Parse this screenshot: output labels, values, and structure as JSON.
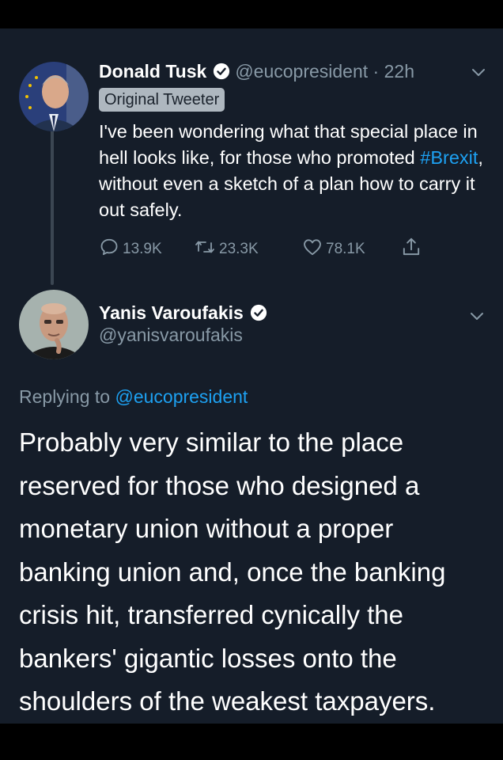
{
  "tweet": {
    "display_name": "Donald Tusk",
    "handle": "@eucopresident",
    "time": "22h",
    "badge": "Original Tweeter",
    "text_before": "I've been wondering what that special place in hell looks like, for those who promoted ",
    "hashtag": "#Brexit",
    "text_after": ", without even a sketch of a plan how to carry it out safely.",
    "replies": "13.9K",
    "retweets": "23.3K",
    "likes": "78.1K"
  },
  "reply": {
    "display_name": "Yanis Varoufakis",
    "handle": "@yanisvaroufakis",
    "replying_prefix": "Replying to",
    "replying_to": "@eucopresident",
    "lines": [
      "Probably very similar to the place",
      "reserved for those who designed a",
      "monetary union without a proper",
      "banking union and, once the banking",
      "crisis hit, transferred cynically the",
      "bankers' gigantic losses onto the",
      "shoulders of the weakest taxpayers."
    ]
  },
  "colors": {
    "background": "#151d29",
    "link": "#1da1f2",
    "muted": "#8899a6"
  },
  "icons": [
    "verified-badge-icon",
    "chevron-down-icon",
    "reply-icon",
    "retweet-icon",
    "like-icon",
    "share-icon"
  ]
}
